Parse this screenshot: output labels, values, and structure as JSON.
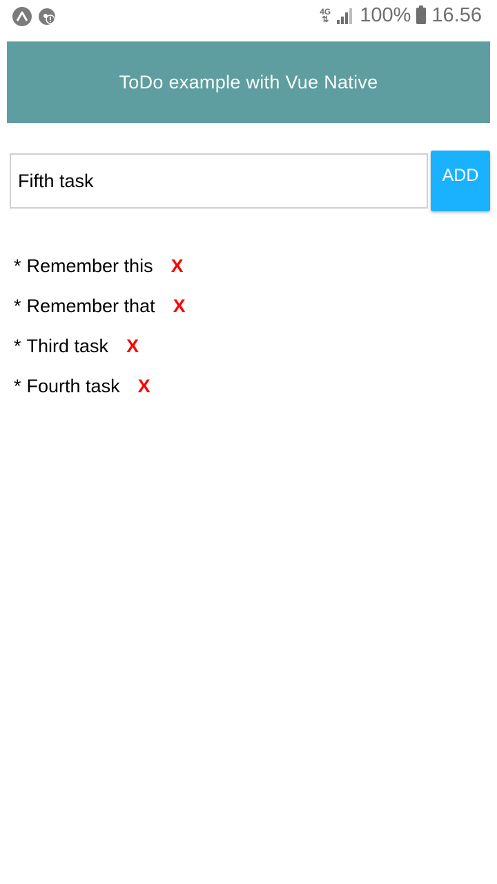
{
  "status_bar": {
    "network_type_top": "4G",
    "network_type_bottom": "⇅",
    "battery_percent": "100%",
    "time": "16.56"
  },
  "header": {
    "title": "ToDo example with Vue Native"
  },
  "form": {
    "input_value": "Fifth task",
    "add_label": "ADD"
  },
  "todos": [
    {
      "bullet": "*",
      "text": "Remember this",
      "delete_label": "X"
    },
    {
      "bullet": "*",
      "text": "Remember that",
      "delete_label": "X"
    },
    {
      "bullet": "*",
      "text": "Third task",
      "delete_label": "X"
    },
    {
      "bullet": "*",
      "text": "Fourth task",
      "delete_label": "X"
    }
  ],
  "colors": {
    "header_bg": "#5f9ea0",
    "add_button_bg": "#1ab2ff",
    "delete_color": "#ff0000"
  }
}
